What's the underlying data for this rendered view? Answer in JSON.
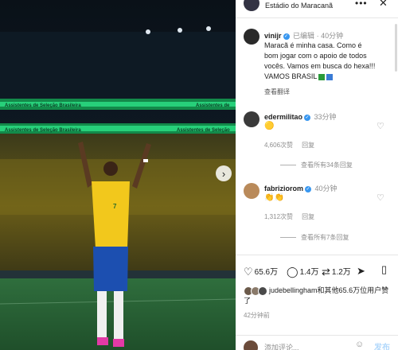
{
  "header": {
    "location": "Estádio do Maracanã",
    "more_icon": "more-dots-icon",
    "close_icon": "close-icon"
  },
  "photo": {
    "banner_text_1": "Assistentes de Seleção Brasileira",
    "banner_text_2": "Assistentes de Seleção Brasileira",
    "banner_right_1": "Assistentes de",
    "banner_right_2": "Assistentes de Seleção",
    "jersey_number": "7",
    "next_icon": "chevron-right-icon"
  },
  "caption": {
    "username": "vinijr",
    "edited": "已编辑",
    "separator": "·",
    "time": "40分钟",
    "text": "Maracã é minha casa. Como é bom jogar com o apoio de todos vocês. Vamos em busca do hexa!!! VAMOS BRASIL",
    "see_translation": "查看翻译"
  },
  "comments": [
    {
      "username": "edermilitao",
      "time": "33分钟",
      "body": "🟡",
      "likes": "4,606次赞",
      "reply": "回复",
      "view_replies": "查看所有34条回复"
    },
    {
      "username": "fabriziorom",
      "time": "40分钟",
      "body": "👏👏",
      "likes": "1,312次赞",
      "reply": "回复",
      "view_replies": "查看所有7条回复"
    }
  ],
  "actions": {
    "likes": "65.6万",
    "comments": "1.4万",
    "reposts": "1.2万",
    "shares": "",
    "like_icon": "heart-icon",
    "comment_icon": "comment-icon",
    "repost_icon": "repost-icon",
    "share_icon": "share-icon",
    "bookmark_icon": "bookmark-icon"
  },
  "liked_by": {
    "text": "judebellingham和其他65.6万位用户赞了",
    "time_ago": "42分钟前"
  },
  "add_comment": {
    "placeholder": "添加评论...",
    "post_label": "发布",
    "emoji_icon": "emoji-icon"
  },
  "colors": {
    "verified_blue": "#3897f0",
    "banner_green": "#27d07a",
    "jersey_yellow": "#f2c81c",
    "shorts_blue": "#1c4fb0"
  }
}
